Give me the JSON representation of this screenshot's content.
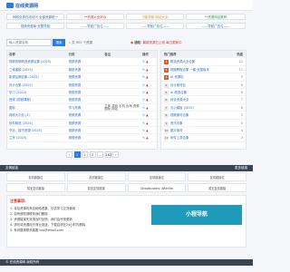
{
  "brand": {
    "logo_text": "在线资源网"
  },
  "top_links": [
    {
      "label": "网络全类在线访问 全部资源统一",
      "color": "#2a6fc9"
    },
    {
      "label": "**资源大全综合",
      "color": "#d9342b"
    },
    {
      "label": "万能导航·网站大全",
      "color": "#e08a00"
    },
    {
      "label": "**资源网站推荐",
      "color": "#2b9b3f"
    }
  ],
  "second_links": [
    {
      "label": "视频资源库·完整导航",
      "color": "#2a6fc9"
    },
    {
      "label": "——导航广告位——",
      "color": "#2a6fc9"
    },
    {
      "label": "——导航广告位——",
      "color": "#2a6fc9"
    },
    {
      "label": "——导航广告位——",
      "color": "#2a6fc9"
    }
  ],
  "search": {
    "placeholder": "输入资源名称",
    "button": "搜索",
    "stats": "共 903 个资源"
  },
  "notice": {
    "label": "通知",
    "text": "最新资源已上线 每日更新中"
  },
  "table_header": {
    "name": "名称",
    "category": "分类",
    "desc": "备注",
    "ops": "操作"
  },
  "rows": [
    {
      "name": "视频剪辑精选资源合集 (2025)",
      "category": "视频资源",
      "desc": ""
    },
    {
      "name": "三维建模 (2023)",
      "category": "模型资源",
      "desc": ""
    },
    {
      "name": "影视后期合集 (2025)",
      "category": "视频资源",
      "desc": ""
    },
    {
      "name": "设计合集 (2025)",
      "category": "视频资源",
      "desc": ""
    },
    {
      "name": "学习 (2023)",
      "category": "视频资源",
      "desc": ""
    },
    {
      "name": "音频 (视频课程)",
      "category": "视频资源",
      "desc": ""
    },
    {
      "name": "图标",
      "category": "学习资源",
      "desc": "立体 游戏 手机 出海 资源 图标 网站"
    },
    {
      "name": "网络大礼包 (1)",
      "category": "视频资源",
      "desc": ""
    },
    {
      "name": "软件精选 (2025)",
      "category": "视频资源",
      "desc": ""
    },
    {
      "name": "书法、楷书资源 (2025)",
      "category": "视频资源",
      "desc": ""
    },
    {
      "name": "兰亭 (2025)",
      "category": "视频资源",
      "desc": ""
    }
  ],
  "sidebar": {
    "title": "热门推荐",
    "col_views": "热度",
    "items": [
      {
        "rank": "1",
        "name": "精选资源大全合集",
        "count": "12"
      },
      {
        "rank": "2",
        "name": "视频教程合集 一套·完整版本",
        "count": "11"
      },
      {
        "rank": "3",
        "name": "AI 资源包",
        "count": "9"
      },
      {
        "rank": "4",
        "name": "设计素材包",
        "count": "8"
      },
      {
        "rank": "5",
        "name": "AI 精选合集",
        "count": "8"
      },
      {
        "rank": "6",
        "name": "综合资源大全",
        "count": "7"
      },
      {
        "rank": "7",
        "name": "办公模板 (2025)",
        "count": "6"
      },
      {
        "rank": "8",
        "name": "视频素材合集",
        "count": "5"
      },
      {
        "rank": "9",
        "name": "音乐合集",
        "count": "5"
      },
      {
        "rank": "10",
        "name": "图片素材",
        "count": "4"
      },
      {
        "rank": "11",
        "name": "软件工具合集",
        "count": "3"
      }
    ]
  },
  "pagination": {
    "pages": [
      "‹",
      "1",
      "2",
      "3",
      "…",
      "162",
      "›"
    ],
    "active": "1"
  },
  "links_section": {
    "title": "友情链接",
    "more": "更多链接"
  },
  "friend_links": [
    "友情链接位",
    "友情链接位",
    "友情链接位",
    "友情链接位"
  ],
  "friend_links_row2": [
    "暂无友情链接",
    "暂无友情链接",
    "Ghostbusters: Afterlife",
    "暂无友情链接"
  ],
  "notes": {
    "title": "注意事项:",
    "lines": [
      "1. 本站资源均来自网络收集，仅供学习交流使用",
      "2. 如有侵权请联系我们删除",
      "3. 资源链接失效请及时反馈，我们会尽快更新",
      "4. 请勿将资源用于商业用途，下载后请在24小时内删除",
      "5. 有问题请联系客服 bro@email.com"
    ]
  },
  "banner": {
    "text": "小程导航"
  },
  "footer": {
    "text": "© 在线资源网 版权所有"
  }
}
